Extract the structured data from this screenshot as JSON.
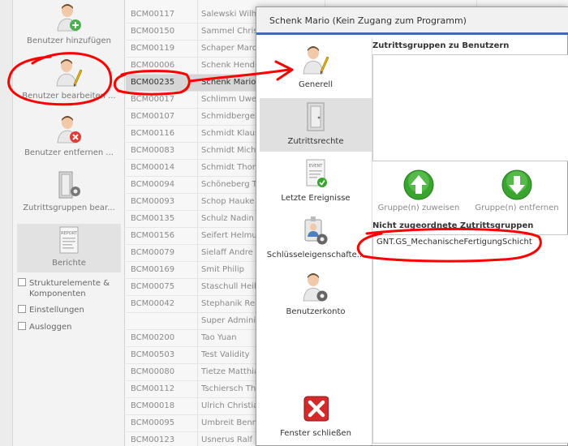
{
  "sidebar": {
    "buttons": [
      {
        "label": "Benutzer hinzufügen",
        "icon": "user-add-icon"
      },
      {
        "label": "Benutzer bearbeiten ...",
        "icon": "user-edit-icon"
      },
      {
        "label": "Benutzer entfernen ...",
        "icon": "user-remove-icon"
      },
      {
        "label": "Zutrittsgruppen bear...",
        "icon": "door-settings-icon"
      },
      {
        "label": "Berichte",
        "icon": "report-icon",
        "icon_text": "REPORT"
      }
    ],
    "checks": [
      {
        "label": "Strukturelemente & Komponenten"
      },
      {
        "label": "Einstellungen"
      },
      {
        "label": "Ausloggen"
      }
    ]
  },
  "table": {
    "rows": [
      {
        "id": "BCM00117",
        "name": "Salewski Wilhelm",
        "c3": "",
        "c4": ""
      },
      {
        "id": "BCM00150",
        "name": "Sammel Christian",
        "c3": "",
        "c4": ""
      },
      {
        "id": "BCM00119",
        "name": "Schaper Marcus",
        "c3": "",
        "c4": ""
      },
      {
        "id": "BCM00006",
        "name": "Schenk Hendrik",
        "c3": "",
        "c4": ""
      },
      {
        "id": "BCM00235",
        "name": "Schenk Mario",
        "c3": "",
        "c4": ""
      },
      {
        "id": "BCM00017",
        "name": "Schlimm Uwe",
        "c3": "",
        "c4": ""
      },
      {
        "id": "BCM00107",
        "name": "Schmidberger",
        "c3": "",
        "c4": ""
      },
      {
        "id": "BCM00116",
        "name": "Schmidt Klaus",
        "c3": "",
        "c4": ""
      },
      {
        "id": "BCM00083",
        "name": "Schmidt Michael",
        "c3": "",
        "c4": ""
      },
      {
        "id": "BCM00014",
        "name": "Schmidt Thomas",
        "c3": "",
        "c4": ""
      },
      {
        "id": "BCM00094",
        "name": "Schöneberg T",
        "c3": "",
        "c4": ""
      },
      {
        "id": "BCM00093",
        "name": "Schop Hauke",
        "c3": "",
        "c4": ""
      },
      {
        "id": "BCM00135",
        "name": "Schulz Nadin",
        "c3": "",
        "c4": ""
      },
      {
        "id": "BCM00156",
        "name": "Seifert Helmut",
        "c3": "",
        "c4": ""
      },
      {
        "id": "BCM00079",
        "name": "Sielaff Andre",
        "c3": "",
        "c4": ""
      },
      {
        "id": "BCM00169",
        "name": "Smit Philip",
        "c3": "",
        "c4": ""
      },
      {
        "id": "BCM00075",
        "name": "Staschull Heiko",
        "c3": "",
        "c4": ""
      },
      {
        "id": "BCM00042",
        "name": "Stephanik Rene",
        "c3": "",
        "c4": ""
      },
      {
        "id": "",
        "name": "Super Administrator",
        "c3": "",
        "c4": ""
      },
      {
        "id": "BCM00200",
        "name": "Tao Yuan",
        "c3": "",
        "c4": ""
      },
      {
        "id": "BCM00503",
        "name": "Test Validity",
        "c3": "",
        "c4": ""
      },
      {
        "id": "BCM00080",
        "name": "Tietze Matthias",
        "c3": "",
        "c4": ""
      },
      {
        "id": "BCM00112",
        "name": "Tschiersch Thomas",
        "c3": "",
        "c4": ""
      },
      {
        "id": "BCM00018",
        "name": "Ulrich Christian",
        "c3": "",
        "c4": ""
      },
      {
        "id": "BCM00095",
        "name": "Umbreit Benno",
        "c3": "",
        "c4": ""
      },
      {
        "id": "BCM00123",
        "name": "Usnerus Ralf",
        "c3": "",
        "c4": ""
      }
    ],
    "selected_index": 4
  },
  "dialog": {
    "title": "Schenk Mario (Kein Zugang zum Programm)",
    "nav": [
      {
        "label": "Generell",
        "icon": "user-edit-icon"
      },
      {
        "label": "Zutrittsrechte",
        "icon": "door-icon"
      },
      {
        "label": "Letzte Ereignisse",
        "icon": "event-icon",
        "icon_text": "EVENT"
      },
      {
        "label": "Schlüsseleigenschafte...",
        "icon": "badge-settings-icon"
      },
      {
        "label": "Benutzerkonto",
        "icon": "user-settings-icon"
      }
    ],
    "close_label": "Fenster schließen",
    "assigned_title": "Zutrittsgruppen zu Benutzern",
    "assign_button": "Gruppe(n) zuweisen",
    "remove_button": "Gruppe(n) entfernen",
    "unassigned_title": "Nicht zugeordnete Zutrittsgruppen",
    "unassigned_items": [
      "GNT.GS_MechanischeFertigungSchicht"
    ]
  },
  "colors": {
    "accent": "#3e6bb4",
    "annotation": "#ff0000",
    "arrow_green": "#3aa52e",
    "close_red": "#d42a2a"
  }
}
